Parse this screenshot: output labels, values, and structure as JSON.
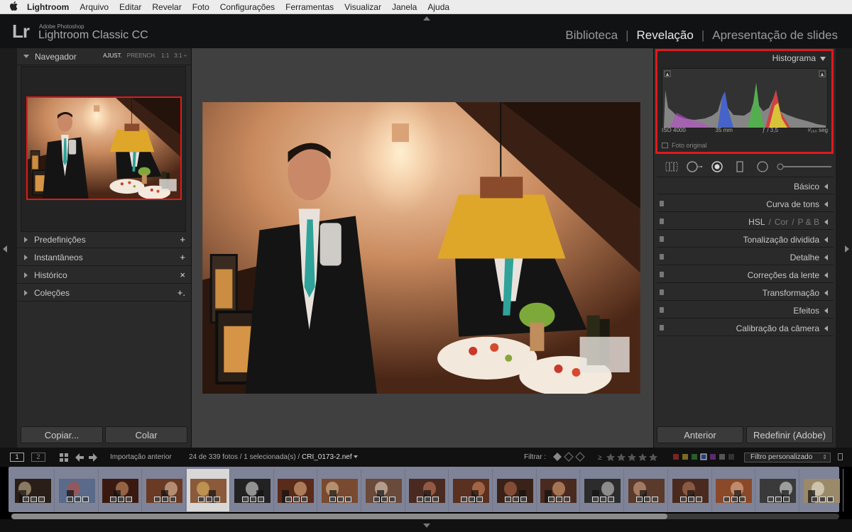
{
  "menubar": {
    "app": "Lightroom",
    "items": [
      "Arquivo",
      "Editar",
      "Revelar",
      "Foto",
      "Configurações",
      "Ferramentas",
      "Visualizar",
      "Janela",
      "Ajuda"
    ]
  },
  "identity": {
    "logo": "Lr",
    "brand_small": "Adobe Photoshop",
    "brand_big": "Lightroom Classic CC"
  },
  "modules": {
    "biblioteca": "Biblioteca",
    "revelacao": "Revelação",
    "apresentacao": "Apresentação de slides",
    "active": "Revelação"
  },
  "left_panel": {
    "navigator_title": "Navegador",
    "zoom_options": [
      "AJUST.",
      "PREENCH.",
      "1:1",
      "3:1 ÷"
    ],
    "sections": [
      {
        "label": "Predefinições",
        "action": "+"
      },
      {
        "label": "Instantâneos",
        "action": "+"
      },
      {
        "label": "Histórico",
        "action": "×"
      },
      {
        "label": "Coleções",
        "action": "+."
      }
    ],
    "copy_button": "Copiar...",
    "paste_button": "Colar"
  },
  "right_panel": {
    "histogram_title": "Histograma",
    "histogram_info": {
      "iso": "ISO 4000",
      "focal": "35 mm",
      "aperture": "ƒ / 3,5",
      "shutter": "¹⁄₁₆₀ seg"
    },
    "original_photo": "Foto original",
    "sections": [
      "Básico",
      "Curva de tons",
      "HSL",
      "Tonalização dividida",
      "Detalhe",
      "Correções da lente",
      "Transformação",
      "Efeitos",
      "Calibração da câmera"
    ],
    "hsl_sub": [
      "Cor",
      "P & B"
    ],
    "prev_button": "Anterior",
    "reset_button": "Redefinir (Adobe)"
  },
  "toolbar": {
    "view1": "1",
    "view2": "2",
    "source": "Importação anterior",
    "count": "24 de 339 fotos / 1 selecionada(s) /",
    "filename": "CRI_0173-2.nef",
    "filter_label": "Filtrar :",
    "filter_select": "Filtro personalizado"
  },
  "filmstrip": {
    "count": 19,
    "selected_index": 4
  },
  "colors": {
    "highlight_red": "#e0191c",
    "filmstrip_bg": "#7e8397"
  }
}
